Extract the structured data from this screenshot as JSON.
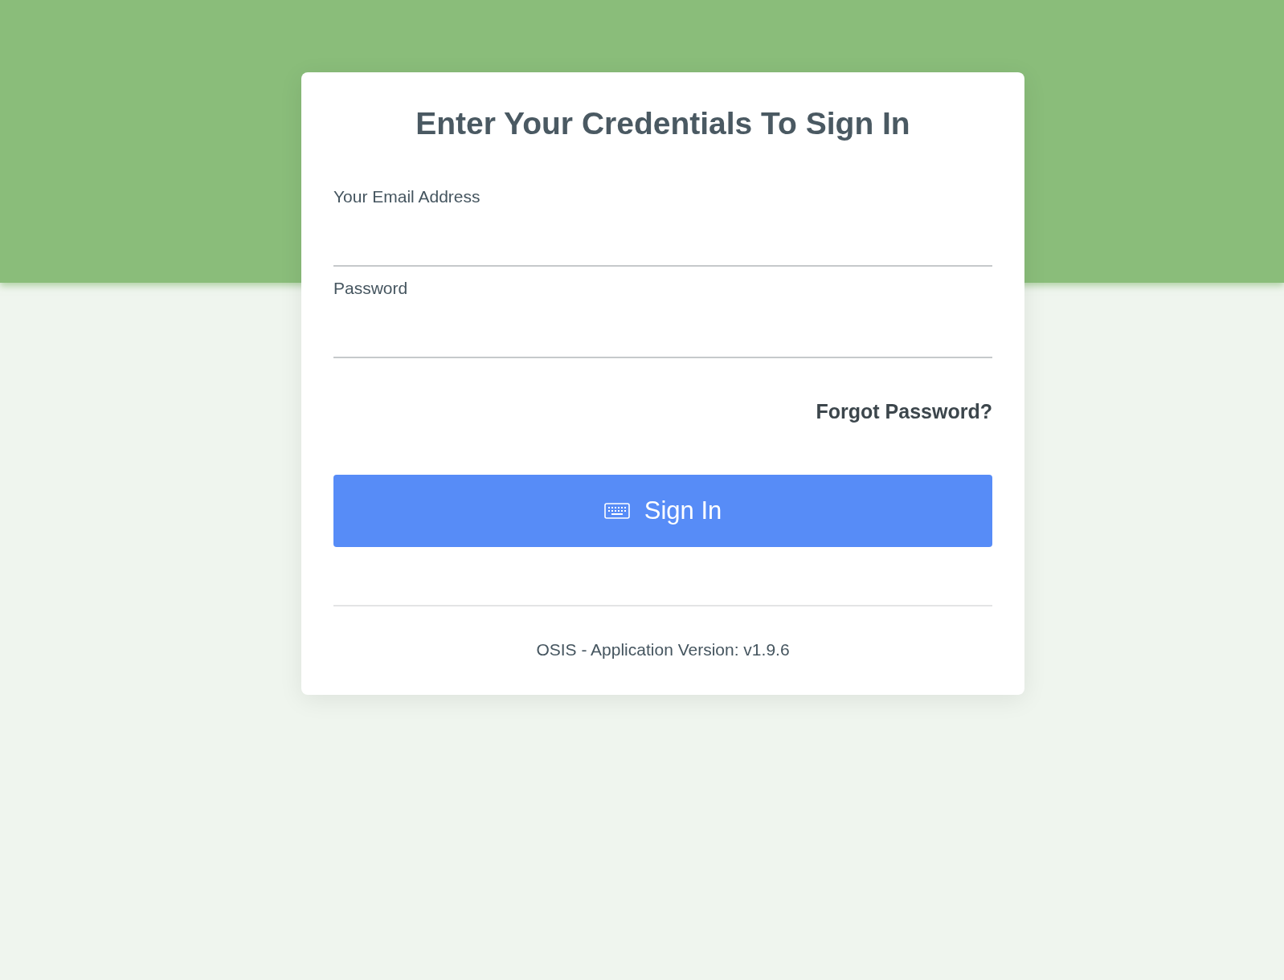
{
  "title": "Enter Your Credentials To Sign In",
  "fields": [
    {
      "label": "Your Email Address"
    },
    {
      "label": "Password"
    }
  ],
  "forgot_link": "Forgot Password?",
  "sign_in_button": "Sign In",
  "footer": "OSIS - Application Version: v1.9.6"
}
